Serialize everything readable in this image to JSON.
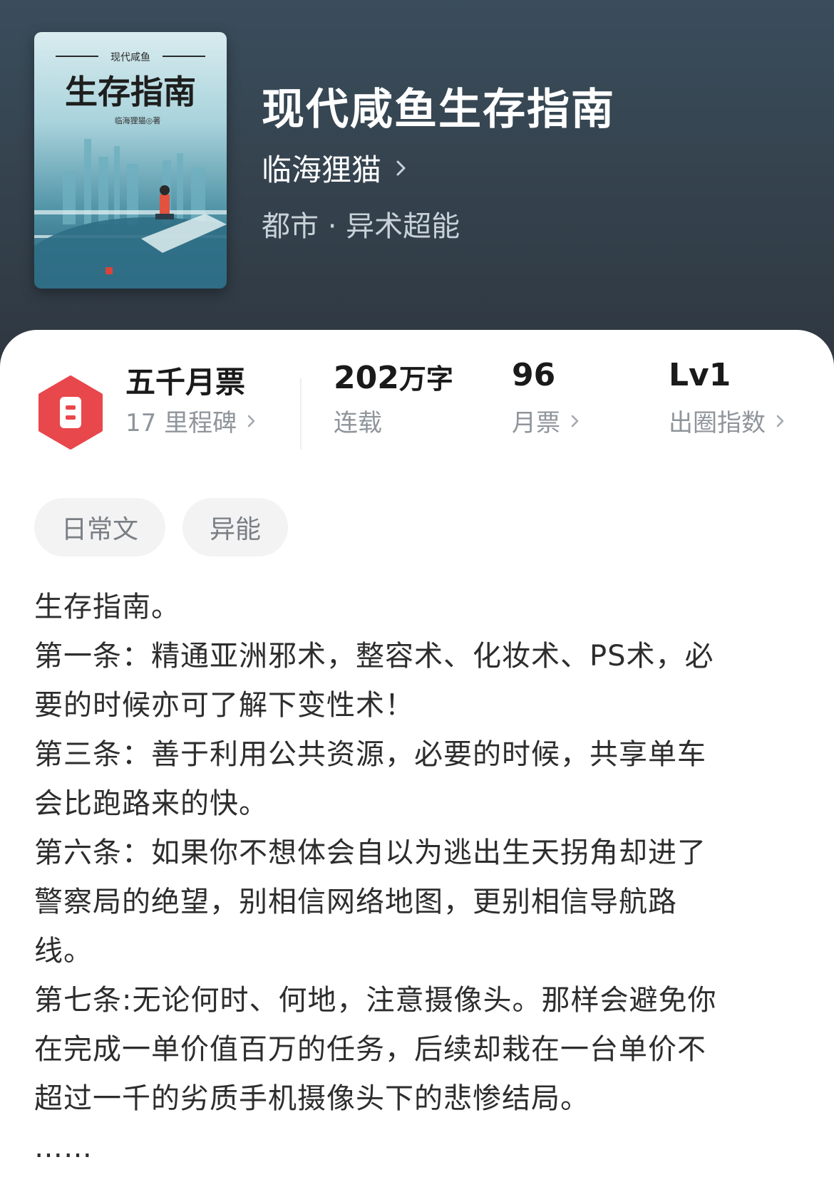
{
  "book": {
    "title": "现代咸鱼生存指南",
    "author": "临海狸猫",
    "category": "都市 · 异术超能",
    "cover": {
      "series_label": "现代咸鱼",
      "title": "生存指南",
      "author_label": "临海狸猫◎著"
    }
  },
  "stats": {
    "monthly_ticket_badge": {
      "title": "五千月票",
      "subtitle": "17 里程碑"
    },
    "word_count": {
      "value": "202",
      "unit": "万字",
      "label": "连载"
    },
    "monthly_tickets": {
      "value": "96",
      "label": "月票"
    },
    "influence": {
      "value": "Lv1",
      "label": "出圈指数"
    }
  },
  "tags": [
    "日常文",
    "异能"
  ],
  "description": [
    "生存指南。",
    "第一条：精通亚洲邪术，整容术、化妆术、PS术，必",
    "要的时候亦可了解下变性术！",
    "第三条：善于利用公共资源，必要的时候，共享单车",
    "会比跑路来的快。",
    "第六条：如果你不想体会自以为逃出生天拐角却进了",
    "警察局的绝望，别相信网络地图，更别相信导航路",
    "线。",
    "第七条:无论何时、何地，注意摄像头。那样会避免你",
    "在完成一单价值百万的任务，后续却栽在一台单价不",
    "超过一千的劣质手机摄像头下的悲惨结局。",
    "……"
  ],
  "colors": {
    "header_top": "#3a4d5c",
    "header_bottom": "#2f3740",
    "badge_red": "#e8474b",
    "muted_text": "#8f959b",
    "tag_bg": "#f3f3f3"
  }
}
